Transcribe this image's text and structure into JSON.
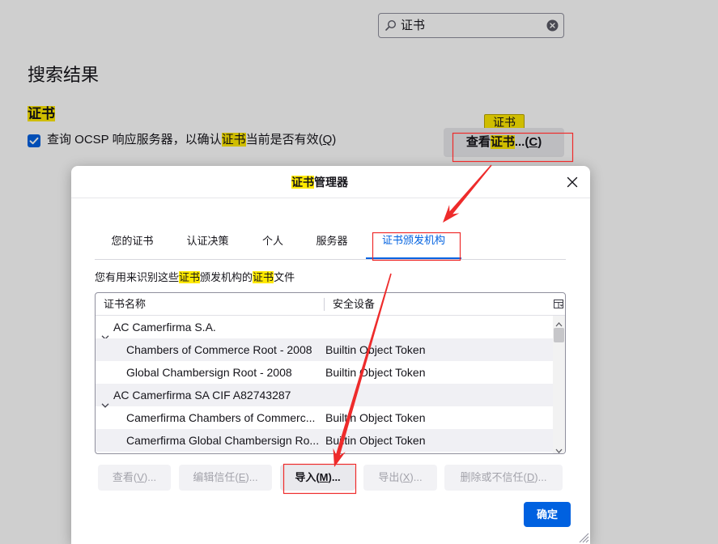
{
  "colors": {
    "accent": "#0061e0",
    "find_highlight": "#ffe900",
    "annotation": "#ee2b2b"
  },
  "settings_page": {
    "search": {
      "value": "证书",
      "icon": "search-icon",
      "clear_icon": "clear-icon"
    },
    "results_heading": "搜索结果",
    "section_title": "证书",
    "ocsp_checkbox": {
      "checked": true,
      "label_pre": "查询 OCSP 响应服务器，以确认",
      "label_highlight": "证书",
      "label_post": "当前是否有效(",
      "accesskey": "Q",
      "label_end": ")"
    },
    "view_certificates_button": {
      "pre": "查看",
      "highlight": "证书",
      "post": "...(",
      "accesskey": "C",
      "end": ")"
    },
    "match_tooltip": "证书"
  },
  "dialog": {
    "title_highlight": "证书",
    "title_rest": "管理器",
    "close_icon": "close-icon",
    "tabs": [
      {
        "label": "您的证书",
        "selected": false
      },
      {
        "label": "认证决策",
        "selected": false
      },
      {
        "label": "个人",
        "selected": false
      },
      {
        "label": "服务器",
        "selected": false
      },
      {
        "label": "证书颁发机构",
        "selected": true
      }
    ],
    "description": {
      "part1": "您有用来识别这些",
      "highlight1": "证书",
      "part2": "颁发机构的",
      "highlight2": "证书",
      "part3": "文件"
    },
    "tree": {
      "columns": [
        "证书名称",
        "安全设备"
      ],
      "column_picker_icon": "column-picker-icon",
      "rows": [
        {
          "group": true,
          "expanded": true,
          "name": "AC Camerfirma S.A.",
          "device": ""
        },
        {
          "group": false,
          "name": "Chambers of Commerce Root - 2008",
          "device": "Builtin Object Token"
        },
        {
          "group": false,
          "name": "Global Chambersign Root - 2008",
          "device": "Builtin Object Token"
        },
        {
          "group": true,
          "expanded": true,
          "name": "AC Camerfirma SA CIF A82743287",
          "device": ""
        },
        {
          "group": false,
          "name": "Camerfirma Chambers of Commerc...",
          "device": "Builtin Object Token"
        },
        {
          "group": false,
          "name": "Camerfirma Global Chambersign Ro...",
          "device": "Builtin Object Token"
        }
      ]
    },
    "buttons": [
      {
        "pre": "查看(",
        "accesskey": "V",
        "post": ")...",
        "enabled": false
      },
      {
        "pre": "编辑信任(",
        "accesskey": "E",
        "post": ")...",
        "enabled": false
      },
      {
        "pre": "导入(",
        "accesskey": "M",
        "post": ")...",
        "enabled": true
      },
      {
        "pre": "导出(",
        "accesskey": "X",
        "post": ")...",
        "enabled": false
      },
      {
        "pre": "删除或不信任(",
        "accesskey": "D",
        "post": ")...",
        "enabled": false
      }
    ],
    "ok_button": "确定",
    "resize_icon": "resize-grip-icon"
  }
}
